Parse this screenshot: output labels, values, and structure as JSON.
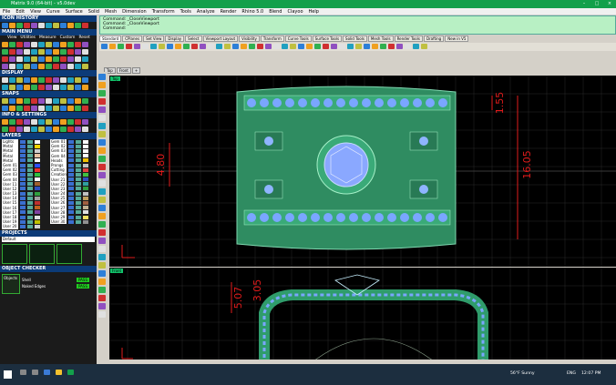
{
  "window": {
    "title": "Matrix 9.0 (64-bit) - v5.0dev"
  },
  "menu": [
    "File",
    "Edit",
    "View",
    "Curve",
    "Surface",
    "Solid",
    "Mesh",
    "Dimension",
    "Transform",
    "Tools",
    "Analyze",
    "Render",
    "Rhino 5.0",
    "Blend",
    "Clayoo",
    "Help"
  ],
  "left_panel": {
    "icon_history": "ICON HISTORY",
    "main_menu": "MAIN MENU",
    "main_menu_items": [
      "View",
      "Utilities",
      "Measure",
      "Custom",
      "Reset"
    ],
    "display": "DISPLAY",
    "snaps": "SNAPS",
    "info_settings": "INFO & SETTINGS",
    "layers": "LAYERS",
    "layers_col1": [
      {
        "name": "Lights",
        "color": "#ffffff"
      },
      {
        "name": "Metal 01",
        "color": "#f5d400"
      },
      {
        "name": "Metal 02",
        "color": "#cfcfcf"
      },
      {
        "name": "Metal 03",
        "color": "#e8c0a0"
      },
      {
        "name": "Metal 04",
        "color": "#ffffff"
      },
      {
        "name": "Gem 01",
        "color": "#3050ff"
      },
      {
        "name": "Gem 02",
        "color": "#f03030"
      },
      {
        "name": "Gem 03",
        "color": "#30c040"
      },
      {
        "name": "Gem 04",
        "color": "#ffffff"
      },
      {
        "name": "User 11",
        "color": "#a06030"
      },
      {
        "name": "User 12",
        "color": "#3050c0"
      },
      {
        "name": "User 13",
        "color": "#30a040"
      },
      {
        "name": "User 14",
        "color": "#a0a0a0"
      },
      {
        "name": "User 15",
        "color": "#c03030"
      },
      {
        "name": "User 16",
        "color": "#c06020"
      },
      {
        "name": "User 17",
        "color": "#8040a0"
      },
      {
        "name": "User 18",
        "color": "#e0e0e0"
      },
      {
        "name": "User 19",
        "color": "#c0c000"
      },
      {
        "name": "User 20",
        "color": "#d0d0d0"
      }
    ],
    "layers_col2": [
      {
        "name": "Gem 01",
        "color": "#ffffff"
      },
      {
        "name": "Gem 02",
        "color": "#ffffff"
      },
      {
        "name": "Gem 03",
        "color": "#ffffff"
      },
      {
        "name": "Gem 04",
        "color": "#ffffff"
      },
      {
        "name": "Heads",
        "color": "#f0c000"
      },
      {
        "name": "Prongs",
        "color": "#c0c0c0"
      },
      {
        "name": "Cutting",
        "color": "#e04040"
      },
      {
        "name": "Creation",
        "color": "#40c040"
      },
      {
        "name": "User 21",
        "color": "#3050c0"
      },
      {
        "name": "User 22",
        "color": "#30a0a0"
      },
      {
        "name": "User 23",
        "color": "#30a040"
      },
      {
        "name": "User 24",
        "color": "#c0c0c0"
      },
      {
        "name": "User 25",
        "color": "#c0a060"
      },
      {
        "name": "User 26",
        "color": "#a06040"
      },
      {
        "name": "User 27",
        "color": "#c0b090"
      },
      {
        "name": "User 28",
        "color": "#e0e0e0"
      },
      {
        "name": "User 29",
        "color": "#f0e060"
      },
      {
        "name": "User 30",
        "color": "#909090"
      }
    ],
    "projects": "PROJECTS",
    "projects_default": "Default",
    "object_checker": "OBJECT CHECKER",
    "objects_label": "Objects",
    "checker": [
      {
        "label": "Shell",
        "status": "PASS"
      },
      {
        "label": "Naked Edges",
        "status": "PASS"
      }
    ]
  },
  "command": {
    "lines": [
      "Command: _CloseViewport",
      "Command: _CloseViewport",
      "Command:"
    ]
  },
  "tabs": [
    "Standard",
    "CPlanes",
    "Set View",
    "Display",
    "Select",
    "Viewport Layout",
    "Visibility",
    "Transform",
    "Curve Tools",
    "Surface Tools",
    "Solid Tools",
    "Mesh Tools",
    "Render Tools",
    "Drafting",
    "New in V5"
  ],
  "viewport_tabs": [
    "Top",
    "Front",
    "+"
  ],
  "viewport_top": {
    "label": "Top",
    "dims": [
      "1.55",
      "4.80",
      "16.05"
    ]
  },
  "viewport_front": {
    "label": "Front",
    "dims": [
      "5.07",
      "3.05"
    ]
  },
  "taskbar": {
    "weather": "56°F Sunny",
    "lang": "ENG",
    "time": "12:07 PM"
  },
  "colors": {
    "accent": "#13a04b",
    "dim": "#e11b1b",
    "ring": "#2f9c6b",
    "gem": "#7aa6ff"
  }
}
